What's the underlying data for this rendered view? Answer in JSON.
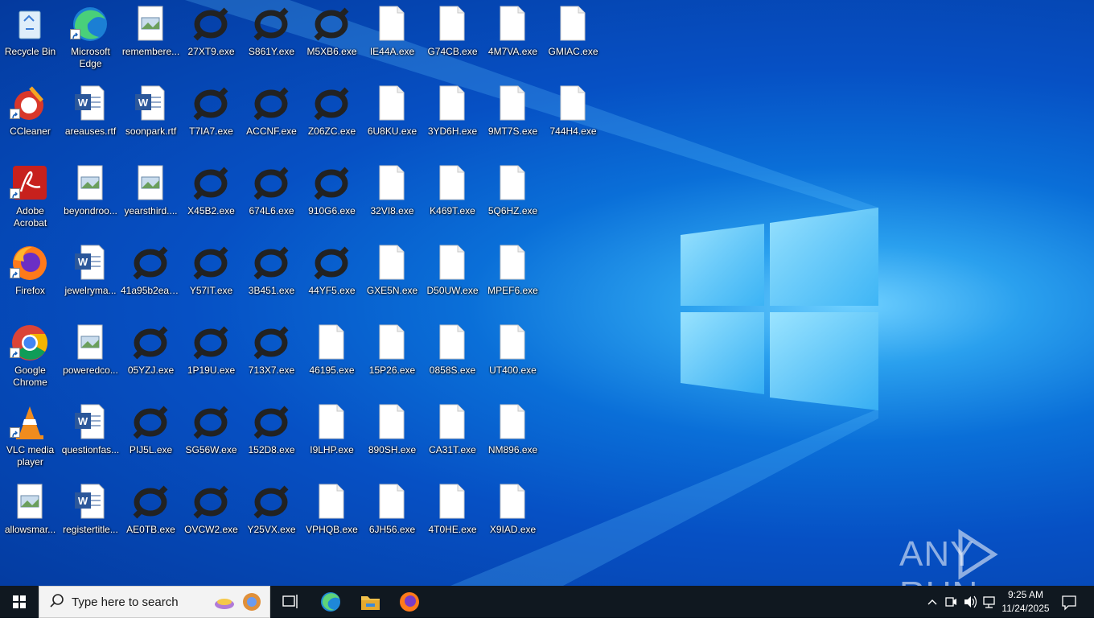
{
  "desktop": {
    "icons": [
      {
        "label": "Recycle Bin",
        "type": "recycle"
      },
      {
        "label": "Microsoft Edge",
        "type": "edge"
      },
      {
        "label": "remembere...",
        "type": "image"
      },
      {
        "label": "27XT9.exe",
        "type": "ring"
      },
      {
        "label": "S861Y.exe",
        "type": "ring"
      },
      {
        "label": "M5XB6.exe",
        "type": "ring"
      },
      {
        "label": "IE44A.exe",
        "type": "blank"
      },
      {
        "label": "G74CB.exe",
        "type": "blank"
      },
      {
        "label": "4M7VA.exe",
        "type": "blank"
      },
      {
        "label": "GMIAC.exe",
        "type": "blank"
      },
      {
        "label": "CCleaner",
        "type": "ccleaner"
      },
      {
        "label": "areauses.rtf",
        "type": "word"
      },
      {
        "label": "soonpark.rtf",
        "type": "word"
      },
      {
        "label": "T7IA7.exe",
        "type": "ring"
      },
      {
        "label": "ACCNF.exe",
        "type": "ring"
      },
      {
        "label": "Z06ZC.exe",
        "type": "ring"
      },
      {
        "label": "6U8KU.exe",
        "type": "blank"
      },
      {
        "label": "3YD6H.exe",
        "type": "blank"
      },
      {
        "label": "9MT7S.exe",
        "type": "blank"
      },
      {
        "label": "744H4.exe",
        "type": "blank"
      },
      {
        "label": "Adobe Acrobat",
        "type": "acrobat"
      },
      {
        "label": "beyondroo...",
        "type": "image"
      },
      {
        "label": "yearsthird....",
        "type": "image"
      },
      {
        "label": "X45B2.exe",
        "type": "ring"
      },
      {
        "label": "674L6.exe",
        "type": "ring"
      },
      {
        "label": "910G6.exe",
        "type": "ring"
      },
      {
        "label": "32VI8.exe",
        "type": "blank"
      },
      {
        "label": "K469T.exe",
        "type": "blank"
      },
      {
        "label": "5Q6HZ.exe",
        "type": "blank"
      },
      {
        "label": "Firefox",
        "type": "firefox"
      },
      {
        "label": "jewelryma...",
        "type": "word"
      },
      {
        "label": "41a95b2ea5...",
        "type": "ring"
      },
      {
        "label": "Y57IT.exe",
        "type": "ring"
      },
      {
        "label": "3B451.exe",
        "type": "ring"
      },
      {
        "label": "44YF5.exe",
        "type": "ring"
      },
      {
        "label": "GXE5N.exe",
        "type": "blank"
      },
      {
        "label": "D50UW.exe",
        "type": "blank"
      },
      {
        "label": "MPEF6.exe",
        "type": "blank"
      },
      {
        "label": "Google Chrome",
        "type": "chrome"
      },
      {
        "label": "poweredco...",
        "type": "image"
      },
      {
        "label": "05YZJ.exe",
        "type": "ring"
      },
      {
        "label": "1P19U.exe",
        "type": "ring"
      },
      {
        "label": "713X7.exe",
        "type": "ring"
      },
      {
        "label": "46195.exe",
        "type": "blank"
      },
      {
        "label": "15P26.exe",
        "type": "blank"
      },
      {
        "label": "0858S.exe",
        "type": "blank"
      },
      {
        "label": "UT400.exe",
        "type": "blank"
      },
      {
        "label": "VLC media player",
        "type": "vlc"
      },
      {
        "label": "questionfas...",
        "type": "word"
      },
      {
        "label": "PIJ5L.exe",
        "type": "ring"
      },
      {
        "label": "SG56W.exe",
        "type": "ring"
      },
      {
        "label": "152D8.exe",
        "type": "ring"
      },
      {
        "label": "I9LHP.exe",
        "type": "blank"
      },
      {
        "label": "890SH.exe",
        "type": "blank"
      },
      {
        "label": "CA31T.exe",
        "type": "blank"
      },
      {
        "label": "NM896.exe",
        "type": "blank"
      },
      {
        "label": "allowsmar...",
        "type": "image"
      },
      {
        "label": "registertitle...",
        "type": "word"
      },
      {
        "label": "AE0TB.exe",
        "type": "ring"
      },
      {
        "label": "OVCW2.exe",
        "type": "ring"
      },
      {
        "label": "Y25VX.exe",
        "type": "ring"
      },
      {
        "label": "VPHQB.exe",
        "type": "blank"
      },
      {
        "label": "6JH56.exe",
        "type": "blank"
      },
      {
        "label": "4T0HE.exe",
        "type": "blank"
      },
      {
        "label": "X9IAD.exe",
        "type": "blank"
      }
    ]
  },
  "watermark": {
    "text": "ANY RUN"
  },
  "taskbar": {
    "search_placeholder": "Type here to search",
    "clock_time": "9:25 AM",
    "clock_date": "11/24/2025",
    "pinned": [
      "task-view",
      "edge",
      "file-explorer",
      "firefox"
    ]
  },
  "colors": {
    "taskbar": "#101820",
    "desktop_accent": "#0a6fd8"
  }
}
